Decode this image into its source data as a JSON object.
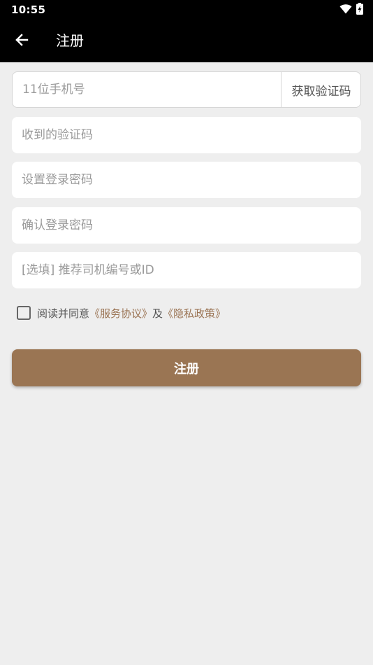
{
  "status_bar": {
    "time": "10:55",
    "icons": [
      "wifi-icon",
      "battery-charging-icon"
    ]
  },
  "app_bar": {
    "back_icon": "arrow-left-icon",
    "title": "注册"
  },
  "form": {
    "phone_placeholder": "11位手机号",
    "get_code_label": "获取验证码",
    "code_placeholder": "收到的验证码",
    "password_placeholder": "设置登录密码",
    "confirm_password_placeholder": "确认登录密码",
    "referrer_placeholder": "[选填] 推荐司机编号或ID"
  },
  "agreement": {
    "checked": false,
    "prefix": "阅读并同意",
    "service_link": "《服务协议》",
    "connector": "及",
    "privacy_link": "《隐私政策》"
  },
  "submit_label": "注册",
  "colors": {
    "bar_background": "#000000",
    "page_background": "#eeeeee",
    "accent": "#9a7553",
    "link": "#9a7353"
  }
}
